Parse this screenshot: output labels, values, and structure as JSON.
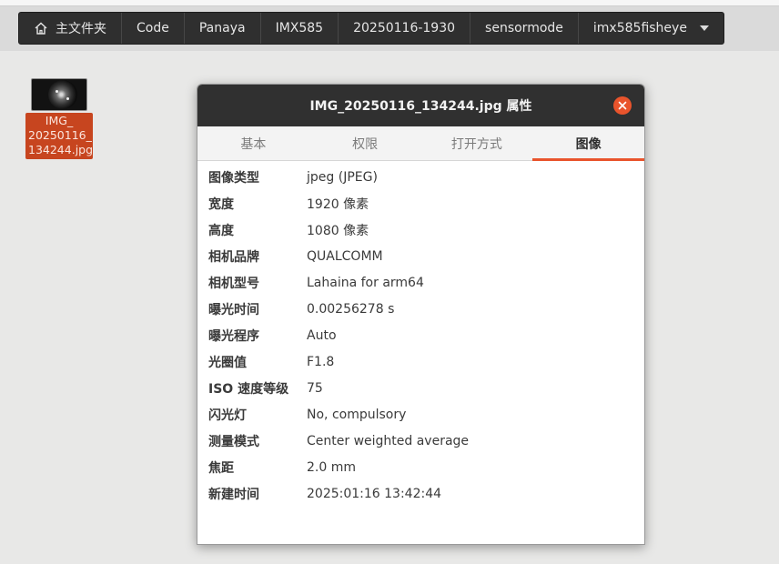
{
  "pathbar": {
    "crumbs": [
      "主文件夹",
      "Code",
      "Panaya",
      "IMX585",
      "20250116-1930",
      "sensormode",
      "imx585fisheye"
    ]
  },
  "desktop": {
    "file": {
      "name_lines": [
        "IMG_",
        "20250116_",
        "134244.jpg"
      ]
    }
  },
  "dialog": {
    "title": "IMG_20250116_134244.jpg 属性",
    "tabs": [
      "基本",
      "权限",
      "打开方式",
      "图像"
    ],
    "active_tab": "图像",
    "properties": [
      {
        "key": "图像类型",
        "value": "jpeg (JPEG)"
      },
      {
        "key": "宽度",
        "value": "1920 像素"
      },
      {
        "key": "高度",
        "value": "1080 像素"
      },
      {
        "key": "相机品牌",
        "value": "QUALCOMM"
      },
      {
        "key": "相机型号",
        "value": "Lahaina for arm64"
      },
      {
        "key": "曝光时间",
        "value": "0.00256278 s"
      },
      {
        "key": "曝光程序",
        "value": "Auto"
      },
      {
        "key": "光圈值",
        "value": "F1.8"
      },
      {
        "key": "ISO 速度等级",
        "value": "75"
      },
      {
        "key": "闪光灯",
        "value": "No, compulsory"
      },
      {
        "key": "测量模式",
        "value": "Center weighted average"
      },
      {
        "key": "焦距",
        "value": "2.0 mm"
      },
      {
        "key": "新建时间",
        "value": "2025:01:16 13:42:44"
      }
    ]
  },
  "colors": {
    "accent": "#e9542c",
    "selection": "#c7451f",
    "titlebar": "#303030",
    "pathbar": "#2f2f2f"
  },
  "icons": {
    "home": "home-icon",
    "dropdown": "chevron-down-icon",
    "close": "close-icon"
  }
}
